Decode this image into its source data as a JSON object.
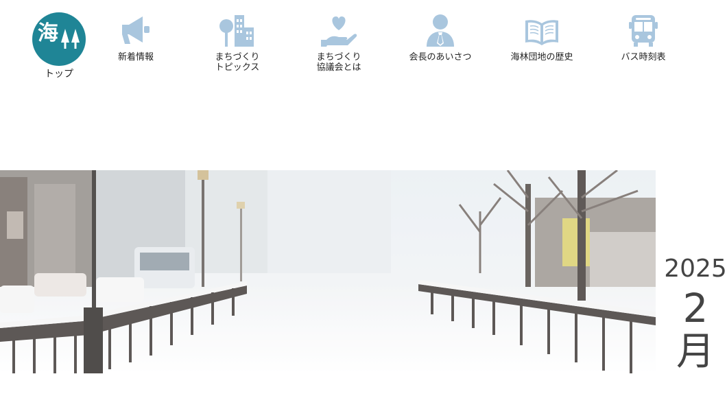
{
  "nav": {
    "home": {
      "logo_text": "海",
      "label": "トップ"
    },
    "items": [
      {
        "label": "新着情報",
        "icon": "megaphone-icon"
      },
      {
        "label": "まちづくり\nトピックス",
        "icon": "town-icon"
      },
      {
        "label": "まちづくり\n協議会とは",
        "icon": "heart-hand-icon"
      },
      {
        "label": "会長のあいさつ",
        "icon": "person-icon"
      },
      {
        "label": "海林団地の歴史",
        "icon": "book-icon"
      },
      {
        "label": "バス時刻表",
        "icon": "bus-icon"
      }
    ]
  },
  "colors": {
    "accent": "#1f8596",
    "icon": "#a9c6de",
    "text": "#222222",
    "date_text": "#444444"
  },
  "hero": {
    "alt": "snowy street with bridge railings"
  },
  "date": {
    "year": "2025",
    "month_num": "2",
    "month_kanji": "月"
  }
}
